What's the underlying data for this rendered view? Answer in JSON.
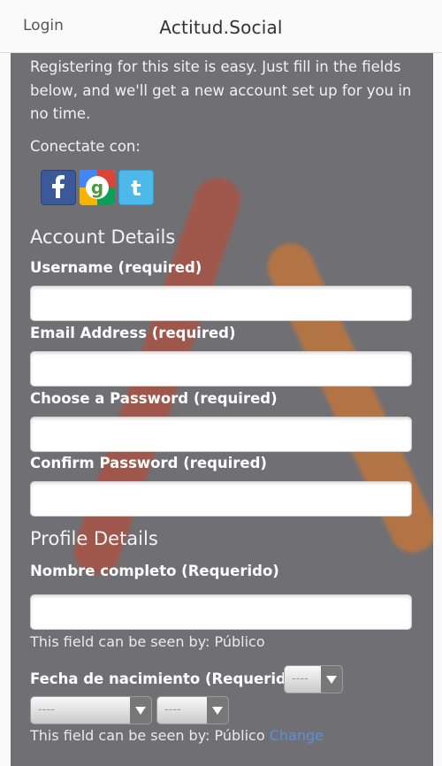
{
  "header": {
    "login_label": "Login",
    "site_title": "Actitud.Social"
  },
  "intro": {
    "text": "Registering for this site is easy. Just fill in the fields below, and we'll get a new account set up for you in no time."
  },
  "social": {
    "label": "Conectate con:",
    "providers": [
      {
        "name": "facebook-icon",
        "color": "#3b5998"
      },
      {
        "name": "google-icon",
        "color": "#4285f4"
      },
      {
        "name": "twitter-icon",
        "color": "#4db8ea"
      }
    ]
  },
  "account": {
    "title": "Account Details",
    "username_label": "Username (required)",
    "username_value": "",
    "email_label": "Email Address (required)",
    "email_value": "",
    "password_label": "Choose a Password (required)",
    "password_value": "",
    "confirm_label": "Confirm Password (required)",
    "confirm_value": ""
  },
  "profile": {
    "title": "Profile Details",
    "fullname_label": "Nombre completo (Requerido)",
    "fullname_value": "",
    "fullname_visibility": "This field can be seen by: Público",
    "birthdate_label": "Fecha de nacimiento (Requerido)",
    "day_value": "----",
    "month_value": "----",
    "year_value": "----",
    "birthdate_visibility": "This field can be seen by: Público",
    "change_label": "Change"
  },
  "colors": {
    "panel_bg": "#707074",
    "link": "#5b8fd6",
    "stroke_red": "#c8432a",
    "stroke_orange": "#e87820"
  }
}
